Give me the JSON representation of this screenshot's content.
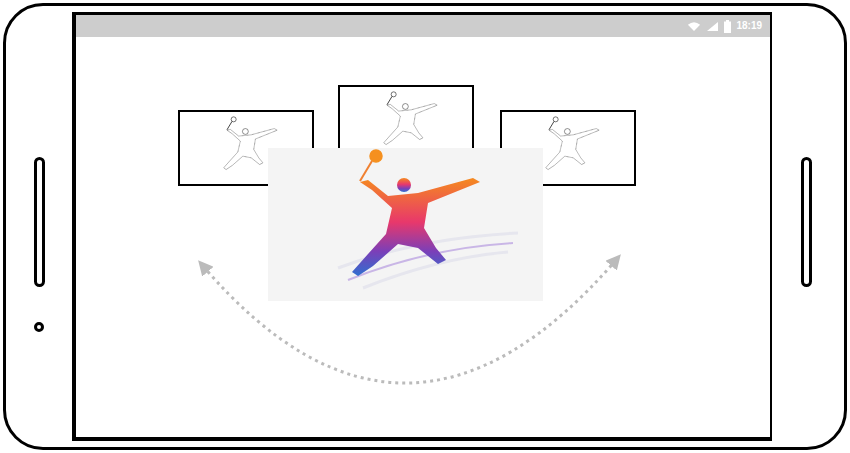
{
  "status_bar": {
    "time": "18:19"
  },
  "carousel": {
    "slides": [
      {
        "selected": false
      },
      {
        "selected": false
      },
      {
        "selected": false
      },
      {
        "selected": true
      }
    ]
  }
}
